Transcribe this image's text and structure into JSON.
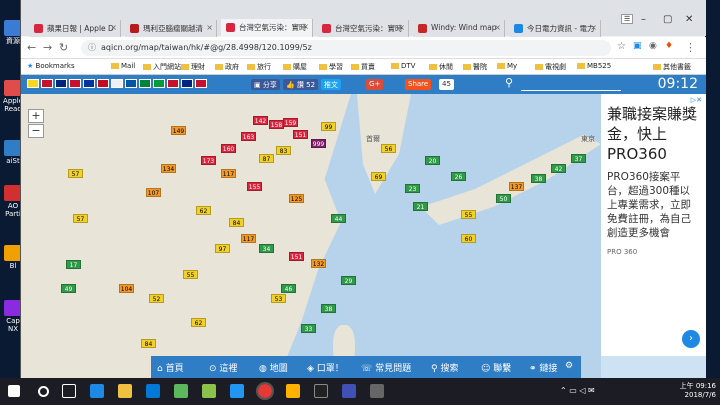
{
  "desktop": {
    "icons": [
      {
        "label": "資源",
        "color": "#3a7bd5"
      },
      {
        "label": "Apple Read",
        "color": "#e04b4b"
      },
      {
        "label": "aiSt",
        "color": "#2f7dc4"
      },
      {
        "label": "AO Parti",
        "color": "#d32f2f"
      },
      {
        "label": "Bl",
        "color": "#f0a000"
      },
      {
        "label": "Cap NX",
        "color": "#8a2be2"
      }
    ]
  },
  "browser": {
    "tabs": [
      {
        "label": "蘋果日報 | Apple D",
        "favicon_color": "#d7263d",
        "active": false
      },
      {
        "label": "瑪利亞腦瘤關越清",
        "favicon_color": "#b71c1c",
        "active": false
      },
      {
        "label": "台灣空氣污染：實時",
        "favicon_color": "#d7263d",
        "active": true
      },
      {
        "label": "台灣空氣污染：實時",
        "favicon_color": "#d7263d",
        "active": false
      },
      {
        "label": "Windy: Wind map",
        "favicon_color": "#c62828",
        "active": false
      },
      {
        "label": "今日電力資訊 - 電力",
        "favicon_color": "#1e88e5",
        "active": false
      }
    ],
    "url": "aqicn.org/map/taiwan/hk/#@g/28.4998/120.1099/5z",
    "bookmarks": [
      {
        "label": "Bookmarks",
        "type": "star"
      },
      {
        "label": "Mail",
        "type": "folder"
      },
      {
        "label": "入門網站",
        "type": "folder"
      },
      {
        "label": "理財",
        "type": "folder"
      },
      {
        "label": "政府",
        "type": "folder"
      },
      {
        "label": "旅行",
        "type": "folder"
      },
      {
        "label": "購屋",
        "type": "folder"
      },
      {
        "label": "學習",
        "type": "folder"
      },
      {
        "label": "買賣",
        "type": "folder"
      },
      {
        "label": "DTV",
        "type": "folder"
      },
      {
        "label": "休閒",
        "type": "folder"
      },
      {
        "label": "醫院",
        "type": "folder"
      },
      {
        "label": "My",
        "type": "folder"
      },
      {
        "label": "電視劇",
        "type": "folder"
      },
      {
        "label": "MB525",
        "type": "folder"
      },
      {
        "label": "其他書籤",
        "type": "folder"
      }
    ]
  },
  "site": {
    "flags": [
      "#f9d71c",
      "#c8102e",
      "#00247d",
      "#c8102e",
      "#0033a0",
      "#c60b1e",
      "#f0f0f0",
      "#0055a4",
      "#00843d",
      "#009b3a",
      "#c8102e",
      "#00247d",
      "#c8102e"
    ],
    "share_fb": "分享",
    "like_count": "讚 52",
    "tweet": "推文",
    "gplus": "G+",
    "share": "Share",
    "share_count": "45",
    "clock": "09:12"
  },
  "map": {
    "labels": [
      {
        "text": "首爾"
      },
      {
        "text": "東京"
      }
    ],
    "markers": [
      {
        "v": "142",
        "c": "r"
      },
      {
        "v": "158",
        "c": "r"
      },
      {
        "v": "159",
        "c": "r"
      },
      {
        "v": "163",
        "c": "r"
      },
      {
        "v": "151",
        "c": "r"
      },
      {
        "v": "999",
        "c": "p"
      },
      {
        "v": "83",
        "c": "y"
      },
      {
        "v": "87",
        "c": "y"
      },
      {
        "v": "99",
        "c": "y"
      },
      {
        "v": "149",
        "c": "o"
      },
      {
        "v": "160",
        "c": "r"
      },
      {
        "v": "173",
        "c": "r"
      },
      {
        "v": "117",
        "c": "o"
      },
      {
        "v": "134",
        "c": "o"
      },
      {
        "v": "107",
        "c": "o"
      },
      {
        "v": "57",
        "c": "y"
      },
      {
        "v": "155",
        "c": "r"
      },
      {
        "v": "125",
        "c": "o"
      },
      {
        "v": "62",
        "c": "y"
      },
      {
        "v": "84",
        "c": "y"
      },
      {
        "v": "57",
        "c": "y"
      },
      {
        "v": "17",
        "c": "g"
      },
      {
        "v": "49",
        "c": "g"
      },
      {
        "v": "104",
        "c": "o"
      },
      {
        "v": "52",
        "c": "y"
      },
      {
        "v": "55",
        "c": "y"
      },
      {
        "v": "97",
        "c": "y"
      },
      {
        "v": "151",
        "c": "r"
      },
      {
        "v": "132",
        "c": "o"
      },
      {
        "v": "117",
        "c": "o"
      },
      {
        "v": "46",
        "c": "g"
      },
      {
        "v": "34",
        "c": "g"
      },
      {
        "v": "29",
        "c": "g"
      },
      {
        "v": "38",
        "c": "g"
      },
      {
        "v": "62",
        "c": "y"
      },
      {
        "v": "84",
        "c": "y"
      },
      {
        "v": "20",
        "c": "g"
      },
      {
        "v": "26",
        "c": "g"
      },
      {
        "v": "23",
        "c": "g"
      },
      {
        "v": "21",
        "c": "g"
      },
      {
        "v": "55",
        "c": "y"
      },
      {
        "v": "50",
        "c": "g"
      },
      {
        "v": "137",
        "c": "o"
      },
      {
        "v": "38",
        "c": "g"
      },
      {
        "v": "42",
        "c": "g"
      },
      {
        "v": "37",
        "c": "g"
      },
      {
        "v": "56",
        "c": "y"
      },
      {
        "v": "69",
        "c": "y"
      },
      {
        "v": "60",
        "c": "y"
      },
      {
        "v": "33",
        "c": "g"
      },
      {
        "v": "53",
        "c": "y"
      },
      {
        "v": "44",
        "c": "g"
      }
    ]
  },
  "ad": {
    "title": "兼職接案賺獎金，快上PRO360",
    "body": "PRO360接案平台，超過300種以上專業需求，立即免費註冊，為自己創造更多機會",
    "brand": "PRO 360",
    "info_icon": "ad-choices-icon"
  },
  "bottom_nav": [
    "首頁",
    "這裡",
    "地圖",
    "口罩！",
    "常見問題",
    "搜索",
    "聯繫",
    "鏈接"
  ],
  "taskbar": {
    "time": "上午 09:16",
    "date": "2018/7/6"
  }
}
